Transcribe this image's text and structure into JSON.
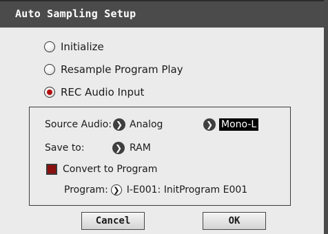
{
  "dialog": {
    "title": "Auto Sampling Setup"
  },
  "options": [
    {
      "label": "Initialize",
      "checked": false
    },
    {
      "label": "Resample Program Play",
      "checked": false
    },
    {
      "label": "REC Audio Input",
      "checked": true
    }
  ],
  "panel": {
    "source_audio_label": "Source Audio:",
    "source_audio_value": "Analog",
    "channel_value": "Mono-L",
    "save_to_label": "Save to:",
    "save_to_value": "RAM",
    "convert_label": "Convert to Program",
    "convert_checked": true,
    "program_label": "Program:",
    "program_value": "I-E001: InitProgram E001"
  },
  "buttons": {
    "cancel": "Cancel",
    "ok": "OK"
  },
  "colors": {
    "titlebar": "#4b4b4b",
    "accent_red": "#b40f0f"
  }
}
